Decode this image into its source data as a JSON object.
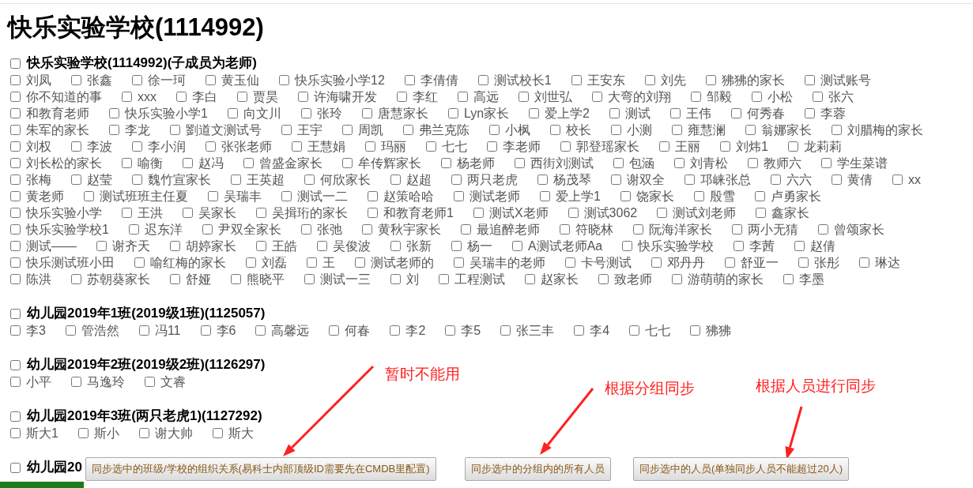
{
  "page_title": "快乐实验学校(1114992)",
  "groups": [
    {
      "title": "快乐实验学校(1114992)(子成员为老师)",
      "checked": false,
      "members": [
        {
          "name": "刘凤",
          "checked": false
        },
        {
          "name": "张鑫",
          "checked": false
        },
        {
          "name": "徐一珂",
          "checked": false
        },
        {
          "name": "黄玉仙",
          "checked": false
        },
        {
          "name": "快乐实验小学12",
          "checked": false
        },
        {
          "name": "李倩倩",
          "checked": false
        },
        {
          "name": "测试校长1",
          "checked": false
        },
        {
          "name": "王安东",
          "checked": false
        },
        {
          "name": "刘先",
          "checked": false
        },
        {
          "name": "狒狒的家长",
          "checked": false
        },
        {
          "name": "测试账号",
          "checked": false
        },
        {
          "name": "你不知道的事",
          "checked": false
        },
        {
          "name": "xxx",
          "checked": false
        },
        {
          "name": "李白",
          "checked": false
        },
        {
          "name": "贾昊",
          "checked": false
        },
        {
          "name": "许海啸开发",
          "checked": false
        },
        {
          "name": "李红",
          "checked": false
        },
        {
          "name": "高远",
          "checked": false
        },
        {
          "name": "刘世弘",
          "checked": false
        },
        {
          "name": "大弯的刘翔",
          "checked": false
        },
        {
          "name": "邹毅",
          "checked": false
        },
        {
          "name": "小松",
          "checked": false
        },
        {
          "name": "张六",
          "checked": false
        },
        {
          "name": "和教育老师",
          "checked": false
        },
        {
          "name": "快乐实验小学1",
          "checked": false
        },
        {
          "name": "向文川",
          "checked": false
        },
        {
          "name": "张玲",
          "checked": false
        },
        {
          "name": "唐慧家长",
          "checked": false
        },
        {
          "name": "Lyn家长",
          "checked": false
        },
        {
          "name": "爱上学2",
          "checked": false
        },
        {
          "name": "测试",
          "checked": false
        },
        {
          "name": "王伟",
          "checked": false
        },
        {
          "name": "何秀春",
          "checked": false
        },
        {
          "name": "李蓉",
          "checked": false
        },
        {
          "name": "朱军的家长",
          "checked": false
        },
        {
          "name": "李龙",
          "checked": false
        },
        {
          "name": "劉道文测试号",
          "checked": false
        },
        {
          "name": "王宇",
          "checked": false
        },
        {
          "name": "周凯",
          "checked": false
        },
        {
          "name": "弗兰克陈",
          "checked": false
        },
        {
          "name": "小枫",
          "checked": false
        },
        {
          "name": "校长",
          "checked": false
        },
        {
          "name": "小测",
          "checked": false
        },
        {
          "name": "雍慧澜",
          "checked": false
        },
        {
          "name": "翁娜家长",
          "checked": false
        },
        {
          "name": "刘腊梅的家长",
          "checked": false
        },
        {
          "name": "刘权",
          "checked": false
        },
        {
          "name": "李波",
          "checked": false
        },
        {
          "name": "李小润",
          "checked": false
        },
        {
          "name": "张张老师",
          "checked": false
        },
        {
          "name": "王慧娟",
          "checked": false
        },
        {
          "name": "玛丽",
          "checked": false
        },
        {
          "name": "七七",
          "checked": false
        },
        {
          "name": "李老师",
          "checked": false
        },
        {
          "name": "郭登瑶家长",
          "checked": false
        },
        {
          "name": "王丽",
          "checked": false
        },
        {
          "name": "刘炜1",
          "checked": false
        },
        {
          "name": "龙莉莉",
          "checked": false
        },
        {
          "name": "刘长松的家长",
          "checked": false
        },
        {
          "name": "喻衡",
          "checked": false
        },
        {
          "name": "赵冯",
          "checked": false
        },
        {
          "name": "曾盛金家长",
          "checked": false
        },
        {
          "name": "牟传辉家长",
          "checked": false
        },
        {
          "name": "杨老师",
          "checked": false
        },
        {
          "name": "西街刘测试",
          "checked": false
        },
        {
          "name": "包涵",
          "checked": false
        },
        {
          "name": "刘青松",
          "checked": false
        },
        {
          "name": "教师六",
          "checked": false
        },
        {
          "name": "学生菜谱",
          "checked": false
        },
        {
          "name": "张梅",
          "checked": false
        },
        {
          "name": "赵莹",
          "checked": false
        },
        {
          "name": "魏竹宣家长",
          "checked": false
        },
        {
          "name": "王英超",
          "checked": false
        },
        {
          "name": "何欣家长",
          "checked": false
        },
        {
          "name": "赵超",
          "checked": false
        },
        {
          "name": "两只老虎",
          "checked": false
        },
        {
          "name": "杨茂琴",
          "checked": false
        },
        {
          "name": "谢双全",
          "checked": false
        },
        {
          "name": "邛崃张总",
          "checked": false
        },
        {
          "name": "六六",
          "checked": false
        },
        {
          "name": "黄倩",
          "checked": false
        },
        {
          "name": "xx",
          "checked": false
        },
        {
          "name": "黄老师",
          "checked": false
        },
        {
          "name": "测试班班主任夏",
          "checked": false
        },
        {
          "name": "吴瑞丰",
          "checked": false
        },
        {
          "name": "测试一二",
          "checked": false
        },
        {
          "name": "赵策哈哈",
          "checked": false
        },
        {
          "name": "测试老师",
          "checked": false
        },
        {
          "name": "爱上学1",
          "checked": false
        },
        {
          "name": "饶家长",
          "checked": false
        },
        {
          "name": "殷雪",
          "checked": false
        },
        {
          "name": "卢勇家长",
          "checked": false
        },
        {
          "name": "快乐实验小学",
          "checked": false
        },
        {
          "name": "王洪",
          "checked": false
        },
        {
          "name": "吴家长",
          "checked": false
        },
        {
          "name": "吴揖珩的家长",
          "checked": false
        },
        {
          "name": "和教育老师1",
          "checked": false
        },
        {
          "name": "测试X老师",
          "checked": false
        },
        {
          "name": "测试3062",
          "checked": false
        },
        {
          "name": "测试刘老师",
          "checked": false
        },
        {
          "name": "鑫家长",
          "checked": false
        },
        {
          "name": "快乐实验学校1",
          "checked": false
        },
        {
          "name": "迟东洋",
          "checked": false
        },
        {
          "name": "尹双全家长",
          "checked": false
        },
        {
          "name": "张弛",
          "checked": false
        },
        {
          "name": "黄秋宇家长",
          "checked": false
        },
        {
          "name": "最追醉老师",
          "checked": false
        },
        {
          "name": "符晓林",
          "checked": false
        },
        {
          "name": "阮海洋家长",
          "checked": false
        },
        {
          "name": "两小无猜",
          "checked": false
        },
        {
          "name": "曾颂家长",
          "checked": false
        },
        {
          "name": "测试——",
          "checked": false
        },
        {
          "name": "谢齐天",
          "checked": false
        },
        {
          "name": "胡婷家长",
          "checked": false
        },
        {
          "name": "王皓",
          "checked": false
        },
        {
          "name": "吴俊波",
          "checked": false
        },
        {
          "name": "张新",
          "checked": false
        },
        {
          "name": "杨一",
          "checked": false
        },
        {
          "name": "A测试老师Aa",
          "checked": false
        },
        {
          "name": "快乐实验学校",
          "checked": false
        },
        {
          "name": "李茜",
          "checked": false
        },
        {
          "name": "赵倩",
          "checked": false
        },
        {
          "name": "快乐测试班小田",
          "checked": false
        },
        {
          "name": "喻红梅的家长",
          "checked": false
        },
        {
          "name": "刘磊",
          "checked": false
        },
        {
          "name": "王",
          "checked": false
        },
        {
          "name": "测试老师的",
          "checked": false
        },
        {
          "name": "吴瑞丰的老师",
          "checked": false
        },
        {
          "name": "卡号测试",
          "checked": false
        },
        {
          "name": "邓丹丹",
          "checked": false
        },
        {
          "name": "舒亚一",
          "checked": false
        },
        {
          "name": "张彤",
          "checked": false
        },
        {
          "name": "琳达",
          "checked": false
        },
        {
          "name": "陈洪",
          "checked": false
        },
        {
          "name": "苏朝葵家长",
          "checked": false
        },
        {
          "name": "舒娅",
          "checked": false
        },
        {
          "name": "熊晓平",
          "checked": false
        },
        {
          "name": "测试一三",
          "checked": false
        },
        {
          "name": "刘",
          "checked": false
        },
        {
          "name": "工程测试",
          "checked": false
        },
        {
          "name": "赵家长",
          "checked": false
        },
        {
          "name": "致老师",
          "checked": false
        },
        {
          "name": "游萌萌的家长",
          "checked": false
        },
        {
          "name": "李墨",
          "checked": false
        }
      ]
    },
    {
      "title": "幼儿园2019年1班(2019级1班)(1125057)",
      "checked": false,
      "members": [
        {
          "name": "李3",
          "checked": false
        },
        {
          "name": "管浩然",
          "checked": false
        },
        {
          "name": "冯11",
          "checked": false
        },
        {
          "name": "李6",
          "checked": false
        },
        {
          "name": "高馨远",
          "checked": false
        },
        {
          "name": "何春",
          "checked": false
        },
        {
          "name": "李2",
          "checked": false
        },
        {
          "name": "李5",
          "checked": false
        },
        {
          "name": "张三丰",
          "checked": false
        },
        {
          "name": "李4",
          "checked": false
        },
        {
          "name": "七七",
          "checked": false
        },
        {
          "name": "狒狒",
          "checked": false
        }
      ]
    },
    {
      "title": "幼儿园2019年2班(2019级2班)(1126297)",
      "checked": false,
      "members": [
        {
          "name": "小平",
          "checked": false
        },
        {
          "name": "马逸玲",
          "checked": false
        },
        {
          "name": "文睿",
          "checked": false
        }
      ]
    },
    {
      "title": "幼儿园2019年3班(两只老虎1)(1127292)",
      "checked": false,
      "members": [
        {
          "name": "斯大1",
          "checked": false
        },
        {
          "name": "斯小",
          "checked": false
        },
        {
          "name": "谢大帅",
          "checked": false
        },
        {
          "name": "斯大",
          "checked": false
        }
      ]
    },
    {
      "title": "幼儿园20",
      "checked": false
    }
  ],
  "buttons": [
    {
      "label": "同步选中的班级/学校的组织关系(易科士内部顶级ID需要先在CMDB里配置)"
    },
    {
      "label": "同步选中的分组内的所有人员"
    },
    {
      "label": "同步选中的人员(单独同步人员不能超过20人)"
    }
  ],
  "annotations": [
    {
      "text": "暂时不能用"
    },
    {
      "text": "根据分组同步"
    },
    {
      "text": "根据人员进行同步"
    }
  ]
}
